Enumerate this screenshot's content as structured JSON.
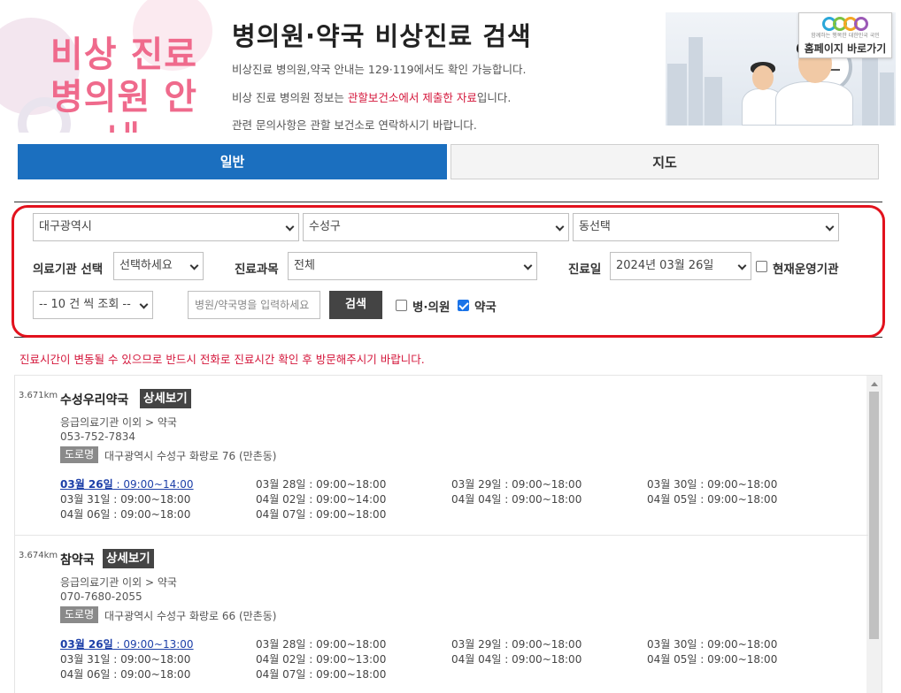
{
  "header": {
    "logo_text": [
      "비상 진료",
      "병의원 안내"
    ],
    "title": "병의원·약국 비상진료 검색",
    "line1": "비상진료 병의원,약국 안내는 129·119에서도 확인 가능합니다.",
    "line2_pre": "비상 진료 병의원 정보는 ",
    "line2_red": "관할보건소에서 제출한 자료",
    "line2_post": "입니다.",
    "line3": "관련 문의사항은 관할 보건소로 연락하시기 바랍니다.",
    "home_button": "홈페이지 바로가기",
    "home_button_tiny": "함께하는 행복한 대한민국 국민"
  },
  "tabs": [
    {
      "label": "일반",
      "active": true
    },
    {
      "label": "지도",
      "active": false
    }
  ],
  "filters": {
    "city": "대구광역시",
    "district": "수성구",
    "dong": "동선택",
    "facility_label": "의료기관 선택",
    "facility_value": "선택하세요",
    "dept_label": "진료과목",
    "dept_value": "전체",
    "date_label": "진료일",
    "date_value": "2024년 03월 26일",
    "open_now_label": "현재운영기관",
    "open_now_checked": false,
    "page_size": "-- 10 건 씩 조회 --",
    "search_placeholder": "병원/약국명을 입력하세요",
    "search_button": "검색",
    "hospital_label": "병·의원",
    "hospital_checked": false,
    "pharmacy_label": "약국",
    "pharmacy_checked": true
  },
  "notice": "진료시간이 변동될 수 있으므로 반드시 전화로 진료시간 확인 후 방문해주시기 바랍니다.",
  "results": [
    {
      "distance": "3.671km",
      "name": "수성우리약국",
      "detail_label": "상세보기",
      "category": "응급의료기관 이외 > 약국",
      "phone": "053-752-7834",
      "road_label": "도로명",
      "address": "대구광역시 수성구 화랑로 76 (만촌동)",
      "hours": [
        {
          "day": "03월 26일",
          "time": "09:00~14:00",
          "today": true
        },
        {
          "day": "03월 28일",
          "time": "09:00~18:00"
        },
        {
          "day": "03월 29일",
          "time": "09:00~18:00"
        },
        {
          "day": "03월 30일",
          "time": "09:00~18:00"
        },
        {
          "day": "03월 31일",
          "time": "09:00~18:00"
        },
        {
          "day": "04월 02일",
          "time": "09:00~14:00"
        },
        {
          "day": "04월 04일",
          "time": "09:00~18:00"
        },
        {
          "day": "04월 05일",
          "time": "09:00~18:00"
        },
        {
          "day": "04월 06일",
          "time": "09:00~18:00"
        },
        {
          "day": "04월 07일",
          "time": "09:00~18:00"
        }
      ]
    },
    {
      "distance": "3.674km",
      "name": "참약국",
      "detail_label": "상세보기",
      "category": "응급의료기관 이외 > 약국",
      "phone": "070-7680-2055",
      "road_label": "도로명",
      "address": "대구광역시 수성구 화랑로 66 (만촌동)",
      "hours": [
        {
          "day": "03월 26일",
          "time": "09:00~13:00",
          "today": true
        },
        {
          "day": "03월 28일",
          "time": "09:00~18:00"
        },
        {
          "day": "03월 29일",
          "time": "09:00~18:00"
        },
        {
          "day": "03월 30일",
          "time": "09:00~18:00"
        },
        {
          "day": "03월 31일",
          "time": "09:00~18:00"
        },
        {
          "day": "04월 02일",
          "time": "09:00~13:00"
        },
        {
          "day": "04월 04일",
          "time": "09:00~18:00"
        },
        {
          "day": "04월 05일",
          "time": "09:00~18:00"
        },
        {
          "day": "04월 06일",
          "time": "09:00~18:00"
        },
        {
          "day": "04월 07일",
          "time": "09:00~18:00"
        }
      ]
    }
  ],
  "colors": {
    "primary_tab": "#1b6fbf",
    "highlight_red": "#e2121d",
    "logo_pink": "#ef6a8c",
    "today_link": "#1c3fa8"
  }
}
